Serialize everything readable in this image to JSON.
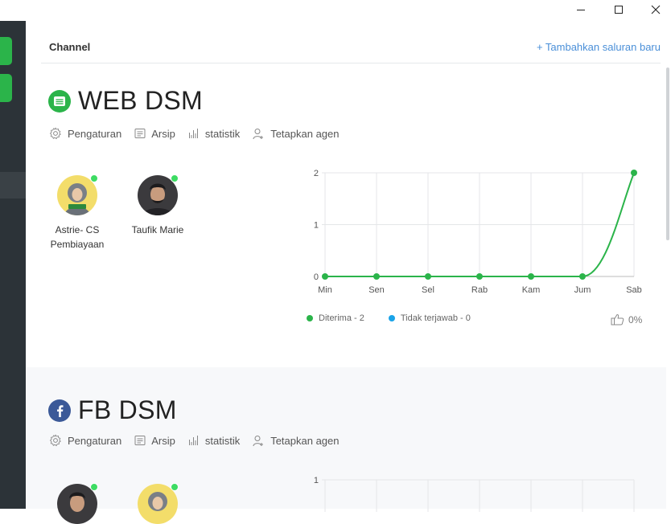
{
  "header": {
    "title": "Channel",
    "add_channel_label": "+ Tambahkan saluran baru"
  },
  "colors": {
    "accent_link": "#4a8fd8",
    "sidebar_bg": "#2c3338",
    "online_green": "#3ddc63",
    "received_green": "#2bb44a",
    "unanswered_blue": "#1aa3e8",
    "web_icon_green": "#2bb44a",
    "fb_icon_blue": "#3b5998"
  },
  "channels": [
    {
      "name": "WEB DSM",
      "icon": "web-chat-icon",
      "actions": [
        {
          "icon": "gear-icon",
          "label": "Pengaturan"
        },
        {
          "icon": "archive-icon",
          "label": "Arsip"
        },
        {
          "icon": "bar-chart-icon",
          "label": "statistik"
        },
        {
          "icon": "assign-agent-icon",
          "label": "Tetapkan agen"
        }
      ],
      "agents": [
        {
          "name_line1": "Astrie- CS",
          "name_line2": "Pembiayaan",
          "online": true
        },
        {
          "name_line1": "Taufik Marie",
          "name_line2": "",
          "online": true
        }
      ],
      "legend": {
        "received": "Diterima - 2",
        "unanswered": "Tidak terjawab - 0"
      },
      "rating": "0%"
    },
    {
      "name": "FB DSM",
      "icon": "facebook-icon",
      "actions": [
        {
          "icon": "gear-icon",
          "label": "Pengaturan"
        },
        {
          "icon": "archive-icon",
          "label": "Arsip"
        },
        {
          "icon": "bar-chart-icon",
          "label": "statistik"
        },
        {
          "icon": "assign-agent-icon",
          "label": "Tetapkan agen"
        }
      ],
      "agents": [
        {
          "online": true
        },
        {
          "online": true
        }
      ]
    }
  ],
  "chart_data": [
    {
      "type": "line",
      "x": [
        "Min",
        "Sen",
        "Sel",
        "Rab",
        "Kam",
        "Jum",
        "Sab"
      ],
      "series": [
        {
          "name": "Diterima",
          "values": [
            0,
            0,
            0,
            0,
            0,
            0,
            2
          ],
          "color": "#2bb44a"
        }
      ],
      "yticks": [
        "0",
        "1",
        "2"
      ],
      "ylim": [
        0,
        2
      ],
      "grid": true
    },
    {
      "type": "line",
      "yticks": [
        "1"
      ],
      "grid": true
    }
  ]
}
